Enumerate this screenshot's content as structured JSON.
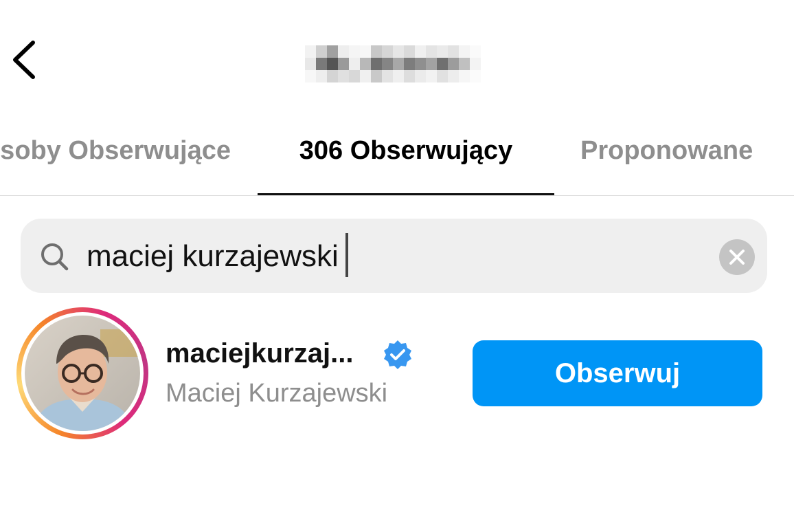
{
  "header": {
    "back_icon": "chevron-left-icon",
    "title_note": "",
    "title_pixel_colors": [
      "#f2f2f2",
      "#cfcfcf",
      "#a0a0a0",
      "#eeeeee",
      "#f5f5f5",
      "#f7f7f7",
      "#c8c8c8",
      "#d6d6d6",
      "#e6e6e6",
      "#dadada",
      "#f0f0f0",
      "#e4e4e4",
      "#eaeaea",
      "#e2e2e2",
      "#f4f4f4",
      "#fafafa",
      "#e8e8e8",
      "#7a7a7a",
      "#555555",
      "#9a9a9a",
      "#eeeeee",
      "#b8b8b8",
      "#6f6f6f",
      "#858585",
      "#a8a8a8",
      "#7d7d7d",
      "#8f8f8f",
      "#a3a3a3",
      "#707070",
      "#9c9c9c",
      "#c0c0c0",
      "#f3f3f3",
      "#f7f7f7",
      "#eeeeee",
      "#d4d4d4",
      "#e0e0e0",
      "#d8d8d8",
      "#f0f0f0",
      "#c9c9c9",
      "#e3e3e3",
      "#efefef",
      "#dddddd",
      "#ebebeb",
      "#f2f2f2",
      "#e1e1e1",
      "#ededed",
      "#f6f6f6",
      "#fbfbfb"
    ]
  },
  "tabs": {
    "left_label": "Osoby Obserwujące",
    "active_label": "306 Obserwujący",
    "right_label": "Proponowane"
  },
  "search": {
    "icon": "search-icon",
    "value": "maciej kurzajewski",
    "clear_icon": "clear-icon"
  },
  "result": {
    "username": "maciejkurzaj...",
    "verified_icon": "verified-badge-icon",
    "full_name": "Maciej Kurzajewski",
    "follow_label": "Obserwuj",
    "follow_color": "#0095f6"
  }
}
